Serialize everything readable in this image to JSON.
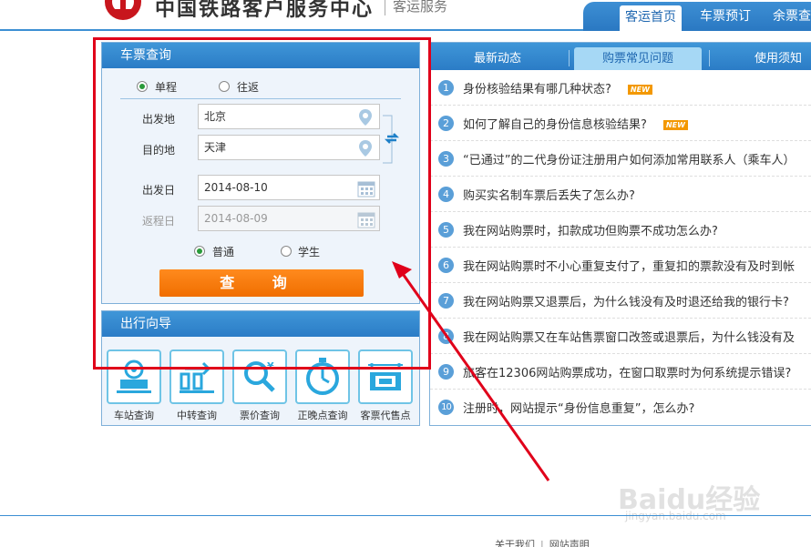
{
  "header": {
    "title": "中国铁路客户服务中心",
    "subtitle": "客运服务",
    "nav": [
      "客运首页",
      "车票预订",
      "余票查询"
    ]
  },
  "query": {
    "title": "车票查询",
    "trip_types": [
      "单程",
      "往返"
    ],
    "from_label": "出发地",
    "from_value": "北京",
    "to_label": "目的地",
    "to_value": "天津",
    "depart_label": "出发日",
    "depart_value": "2014-08-10",
    "return_label": "返程日",
    "return_value": "2014-08-09",
    "passenger_types": [
      "普通",
      "学生"
    ],
    "submit": "查 询"
  },
  "guide": {
    "title": "出行向导",
    "items": [
      "车站查询",
      "中转查询",
      "票价查询",
      "正晚点查询",
      "客票代售点"
    ]
  },
  "faq": {
    "tabs": [
      "最新动态",
      "购票常见问题",
      "使用须知"
    ],
    "new_badge": "NEW",
    "items": [
      {
        "num": "1",
        "text": "身份核验结果有哪几种状态?"
      },
      {
        "num": "2",
        "text": "如何了解自己的身份信息核验结果?"
      },
      {
        "num": "3",
        "text": "“已通过”的二代身份证注册用户如何添加常用联系人（乘车人）"
      },
      {
        "num": "4",
        "text": "购买实名制车票后丢失了怎么办?"
      },
      {
        "num": "5",
        "text": "我在网站购票时，扣款成功但购票不成功怎么办?"
      },
      {
        "num": "6",
        "text": "我在网站购票时不小心重复支付了，重复扣的票款没有及时到帐"
      },
      {
        "num": "7",
        "text": "我在网站购票又退票后，为什么钱没有及时退还给我的银行卡?"
      },
      {
        "num": "8",
        "text": "我在网站购票又在车站售票窗口改签或退票后，为什么钱没有及"
      },
      {
        "num": "9",
        "text": "旅客在12306网站购票成功，在窗口取票时为何系统提示错误?"
      },
      {
        "num": "10",
        "text": "注册时，网站提示“身份信息重复”，怎么办?"
      }
    ]
  },
  "footer": {
    "links": [
      "关于我们",
      "网站声明"
    ]
  },
  "watermark": {
    "text": "Baidu经验",
    "url": "jingyan.baidu.com"
  },
  "colors": {
    "brand_blue": "#2b7cc6",
    "button_orange": "#f06e00",
    "highlight_red": "#e0001a"
  }
}
